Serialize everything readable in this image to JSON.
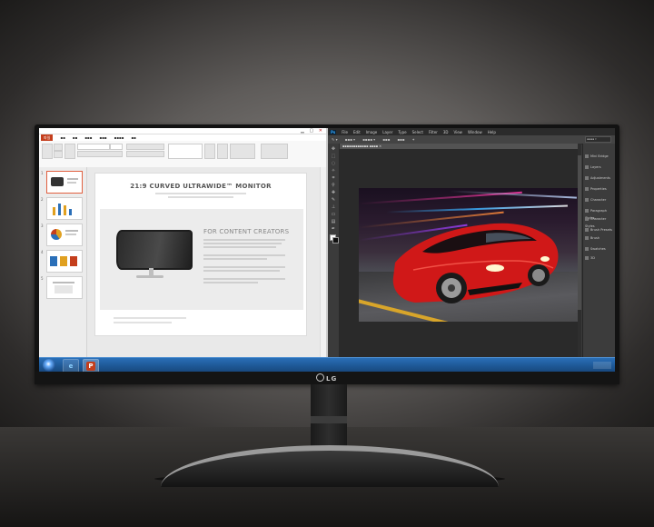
{
  "monitor": {
    "brand": "LG"
  },
  "powerpoint": {
    "file_tab": "파일",
    "thumbnail_numbers": [
      "1",
      "2",
      "3",
      "4",
      "5"
    ],
    "slide": {
      "title": "21:9 CURVED ULTRAWIDE™ MONITOR",
      "heading": "FOR CONTENT CREATORS"
    }
  },
  "photoshop": {
    "logo": "Ps",
    "menu": [
      "File",
      "Edit",
      "Image",
      "Layer",
      "Type",
      "Select",
      "Filter",
      "3D",
      "View",
      "Window",
      "Help"
    ],
    "panels": [
      "Mini Bridge",
      "Layers",
      "Adjustments",
      "Properties",
      "Character",
      "Paragraph Styles",
      "Character Styles",
      "Brush Presets",
      "Brush",
      "Swatches",
      "3D"
    ]
  },
  "taskbar": {
    "apps": [
      "start-button",
      "ie-icon",
      "powerpoint-icon"
    ]
  },
  "colors": {
    "ppt_accent": "#c43e1c",
    "taskbar": "#1f5a99",
    "ps_bg": "#3a3a3a",
    "car_red": "#d01818"
  }
}
